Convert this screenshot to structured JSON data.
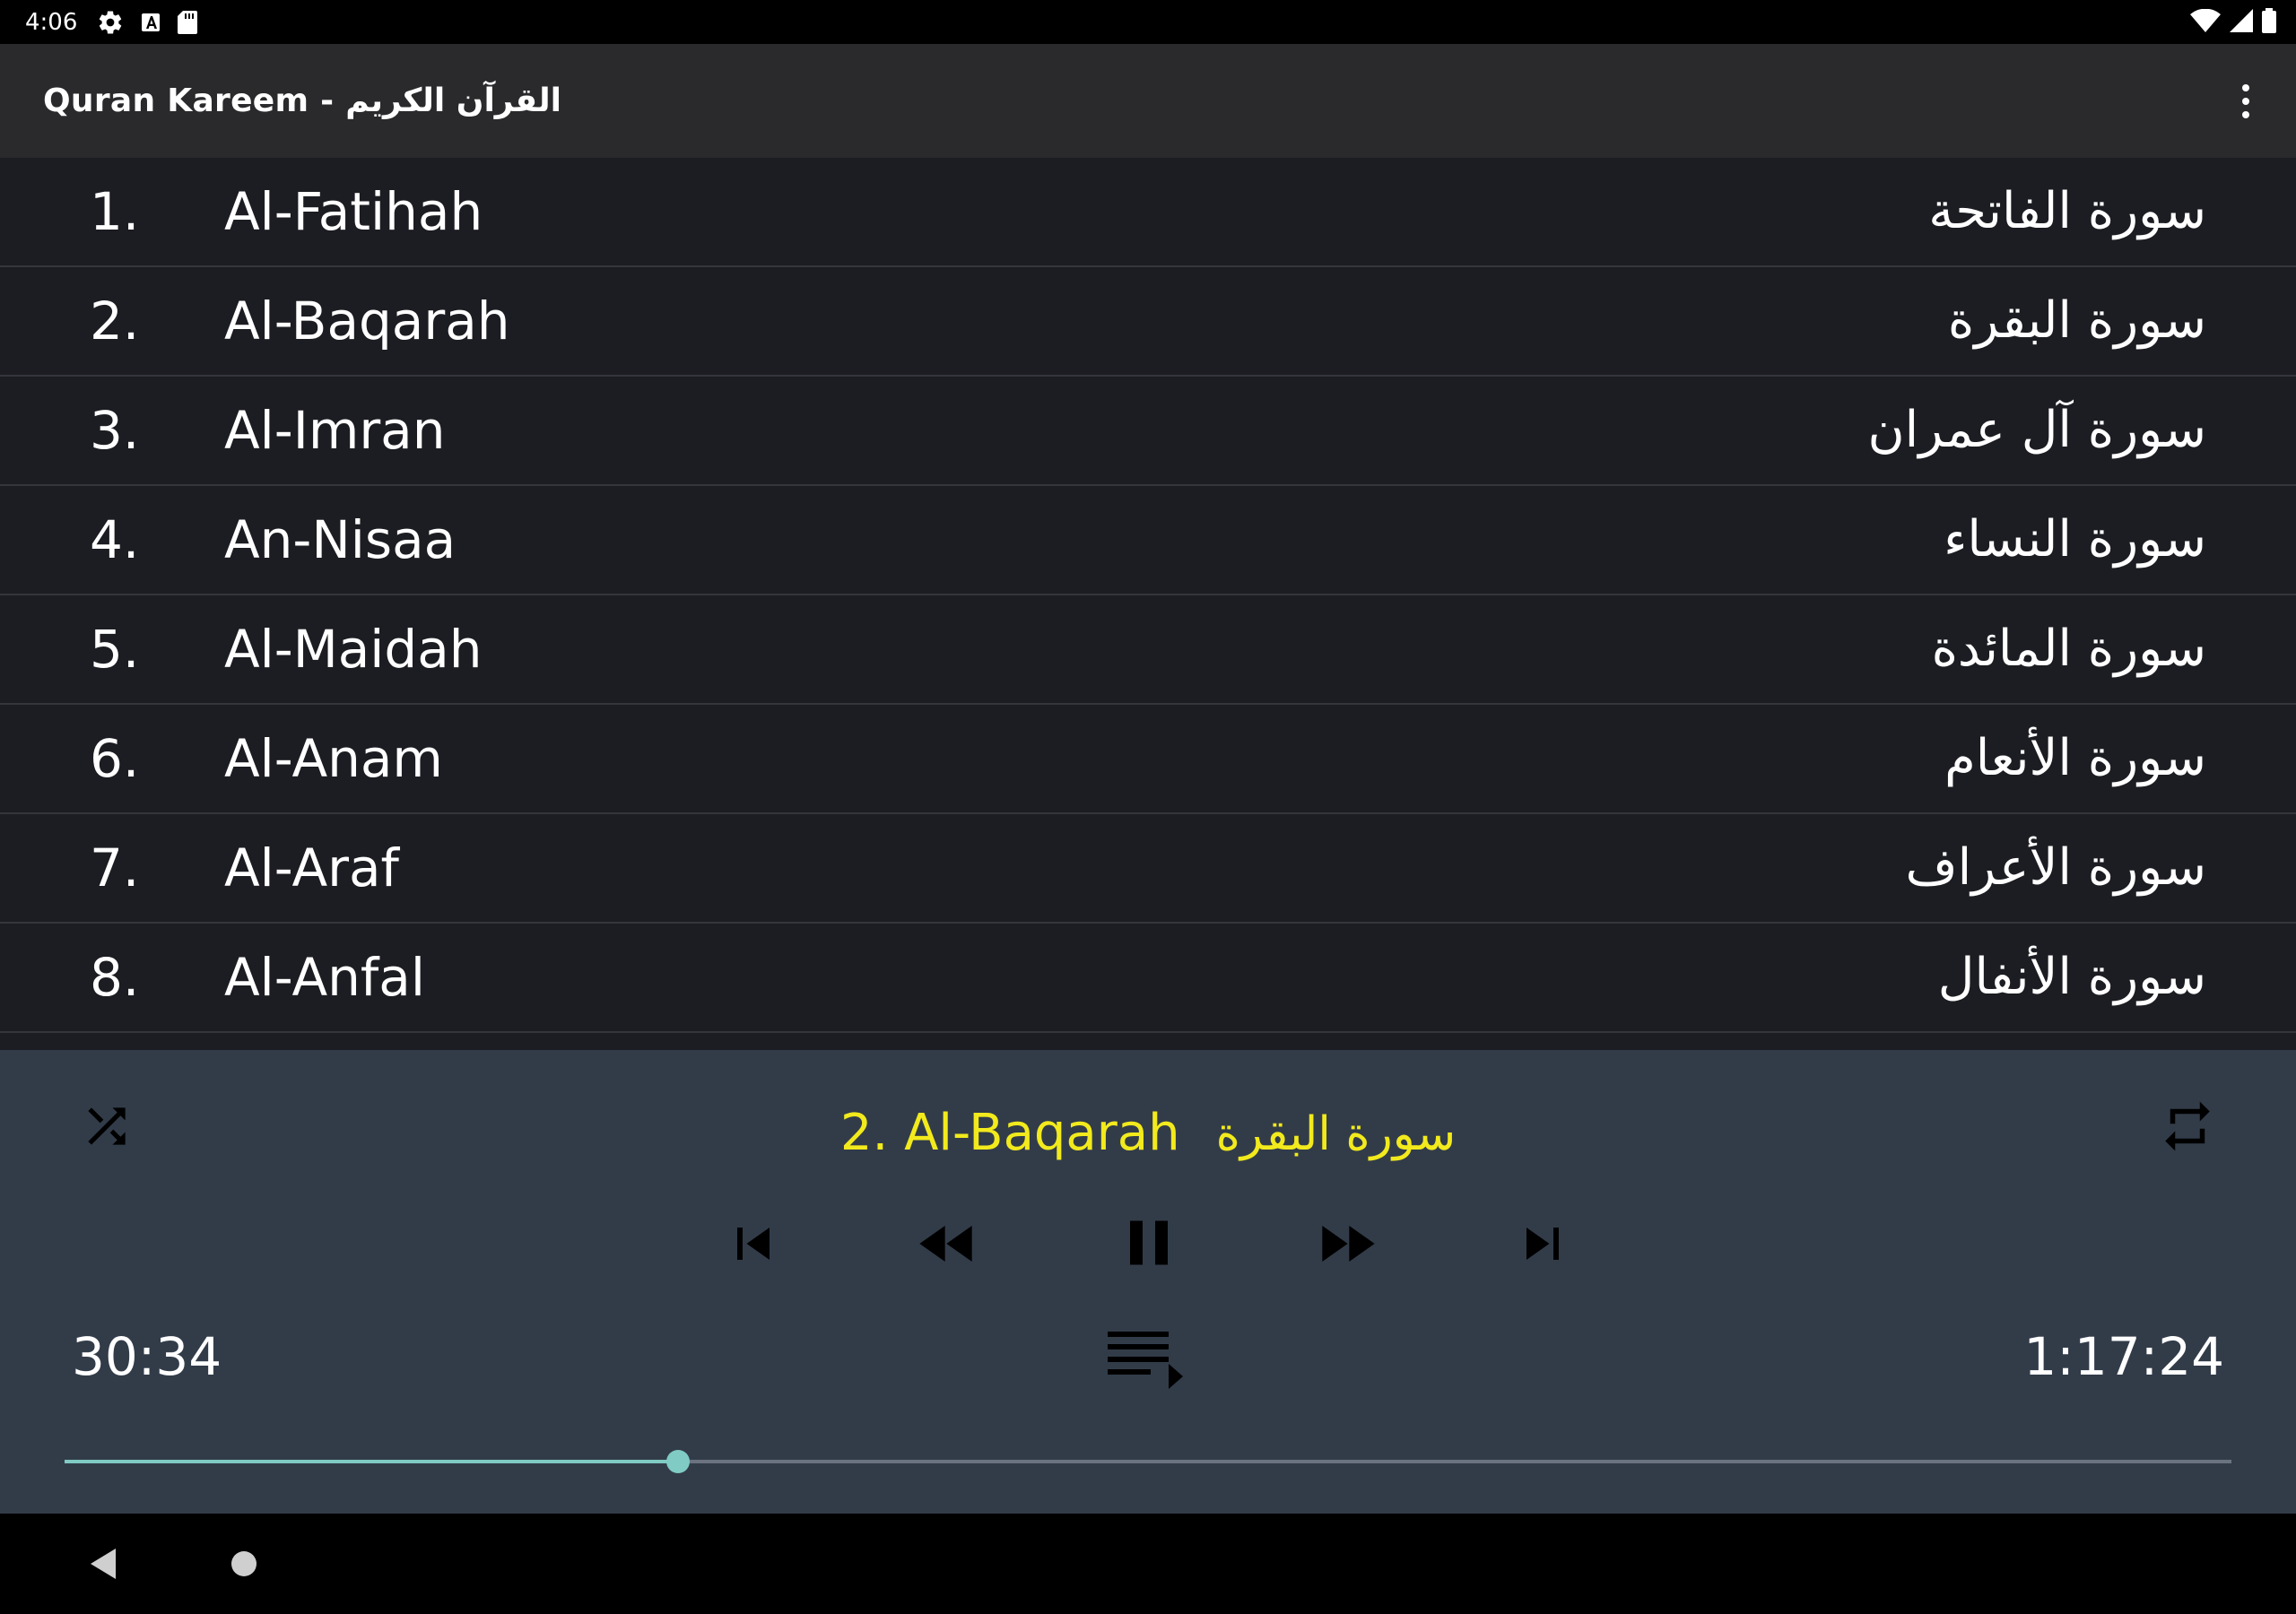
{
  "status_bar": {
    "time": "4:06",
    "icons_left": [
      "settings-icon",
      "a-icon",
      "sd-card-icon"
    ],
    "icons_right": [
      "wifi-icon",
      "signal-icon",
      "battery-icon"
    ]
  },
  "app_bar": {
    "title": "Quran Kareem - القرآن الكريم",
    "overflow_icon": "more-vert-icon"
  },
  "surahs": [
    {
      "num": "1.",
      "name": "Al-Fatihah",
      "arabic": "سورة الفاتحة"
    },
    {
      "num": "2.",
      "name": "Al-Baqarah",
      "arabic": "سورة البقرة"
    },
    {
      "num": "3.",
      "name": "Al-Imran",
      "arabic": "سورة آل عمران"
    },
    {
      "num": "4.",
      "name": "An-Nisaa",
      "arabic": "سورة النساء"
    },
    {
      "num": "5.",
      "name": "Al-Maidah",
      "arabic": "سورة المائدة"
    },
    {
      "num": "6.",
      "name": "Al-Anam",
      "arabic": "سورة الأنعام"
    },
    {
      "num": "7.",
      "name": "Al-Araf",
      "arabic": "سورة الأعراف"
    },
    {
      "num": "8.",
      "name": "Al-Anfal",
      "arabic": "سورة الأنفال"
    }
  ],
  "player": {
    "now_playing": "2. Al-Baqarah",
    "now_playing_arabic": "سورة البقرة",
    "elapsed": "30:34",
    "duration": "1:17:24",
    "progress": 0.283,
    "icons": [
      "shuffle-icon",
      "repeat-icon",
      "skip-previous-icon",
      "rewind-icon",
      "pause-icon",
      "fast-forward-icon",
      "skip-next-icon",
      "playlist-icon"
    ],
    "colors": {
      "title": "#f2ea1c",
      "accent": "#80cbc4",
      "background": "#323c49"
    }
  },
  "nav_bar": {
    "icons": [
      "back-icon",
      "home-icon"
    ]
  }
}
